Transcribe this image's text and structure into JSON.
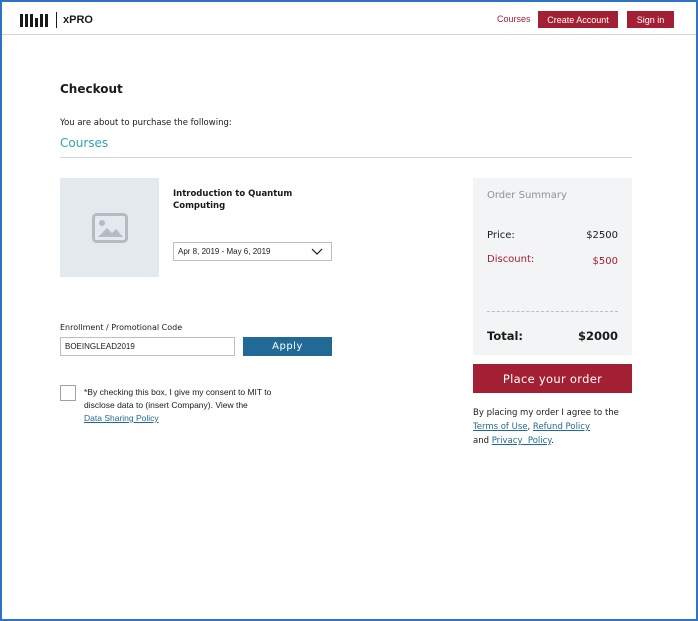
{
  "header": {
    "brand": "xPRO",
    "courses_link": "Courses",
    "create_account": "Create Account",
    "sign_in": "Sign in"
  },
  "page": {
    "title": "Checkout",
    "subtitle": "You are about to purchase the following:",
    "section": "Courses"
  },
  "course": {
    "name": "Introduction to Quantum Computing",
    "date_range": "Apr 8, 2019 - May 6, 2019"
  },
  "promo": {
    "label": "Enrollment / Promotional Code",
    "value": "BOEINGLEAD2019",
    "apply": "Apply"
  },
  "consent": {
    "text": "*By checking this box, I give my consent to MIT to disclose data to (insert Company). View the",
    "link": "Data Sharing Policy",
    "checked": false
  },
  "summary": {
    "title": "Order Summary",
    "price_label": "Price:",
    "price": "$2500",
    "discount_label": "Discount:",
    "discount": "$500",
    "total_label": "Total:",
    "total": "$2000"
  },
  "place_order": "Place your order",
  "agreement": {
    "prefix": "By placing my order I agree to the",
    "terms": "Terms of Use",
    "refund": "Refund Policy",
    "and": "and",
    "privacy": "Privacy  Policy"
  },
  "colors": {
    "accent_red": "#a31f34",
    "accent_blue": "#216a96",
    "section_teal": "#2ea3b5"
  },
  "icons": [
    "mit-logo",
    "image-placeholder-icon",
    "chevron-down-icon"
  ]
}
